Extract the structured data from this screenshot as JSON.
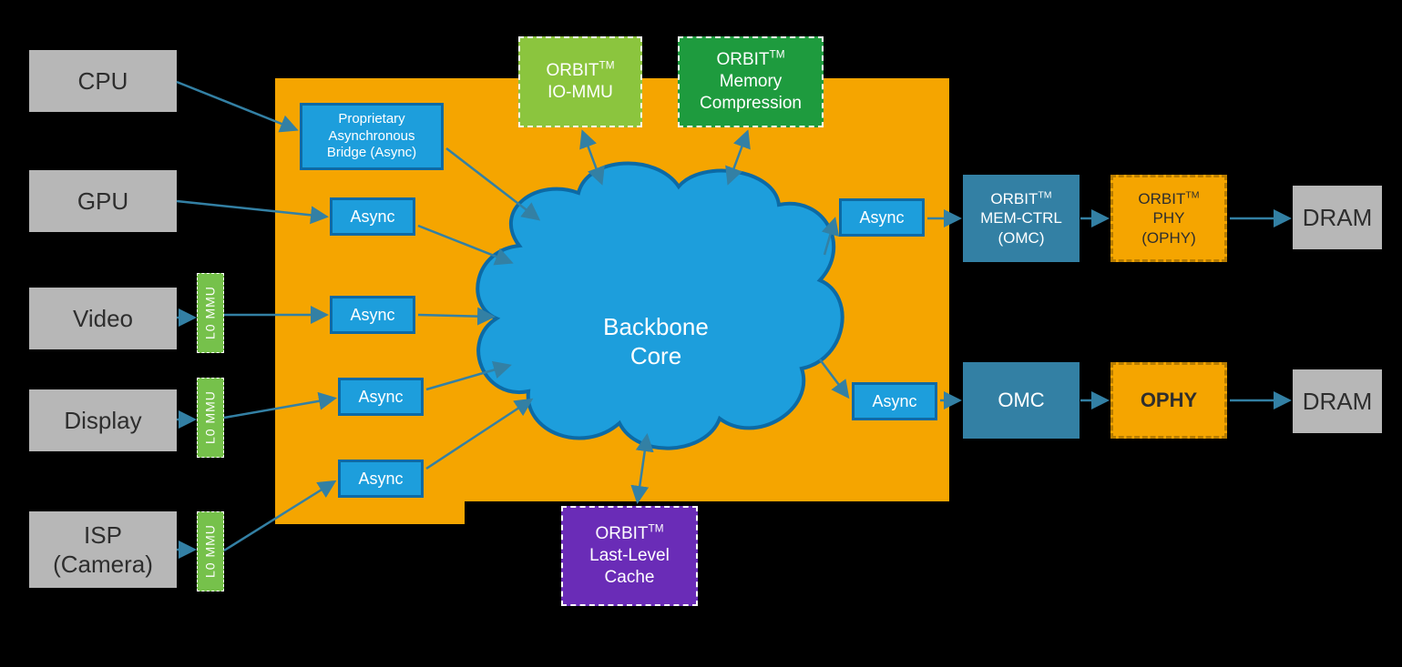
{
  "brand": "ORBIT",
  "tm": "TM",
  "ip_blocks": {
    "cpu": "CPU",
    "gpu": "GPU",
    "video": "Video",
    "display": "Display",
    "isp_line1": "ISP",
    "isp_line2": "(Camera)"
  },
  "l0mmu_label": "L0 MMU",
  "async_label": "Async",
  "proprietary_async": "Proprietary\nAsynchronous\nBridge (Async)",
  "backbone_core": "Backbone\nCore",
  "iommu_label": "IO-MMU",
  "memcomp_line1": "Memory",
  "memcomp_line2": "Compression",
  "llc_line1": "Last-Level",
  "llc_line2": "Cache",
  "omc_line1": "MEM-CTRL",
  "omc_line2": "(OMC)",
  "omc_short": "OMC",
  "ophy_line1": "PHY",
  "ophy_line2": "(OPHY)",
  "ophy_short": "OPHY",
  "dram": "DRAM",
  "colors": {
    "arrow": "#3380a4",
    "cloud_fill": "#1d9edc",
    "cloud_stroke": "#0c6aa5"
  }
}
